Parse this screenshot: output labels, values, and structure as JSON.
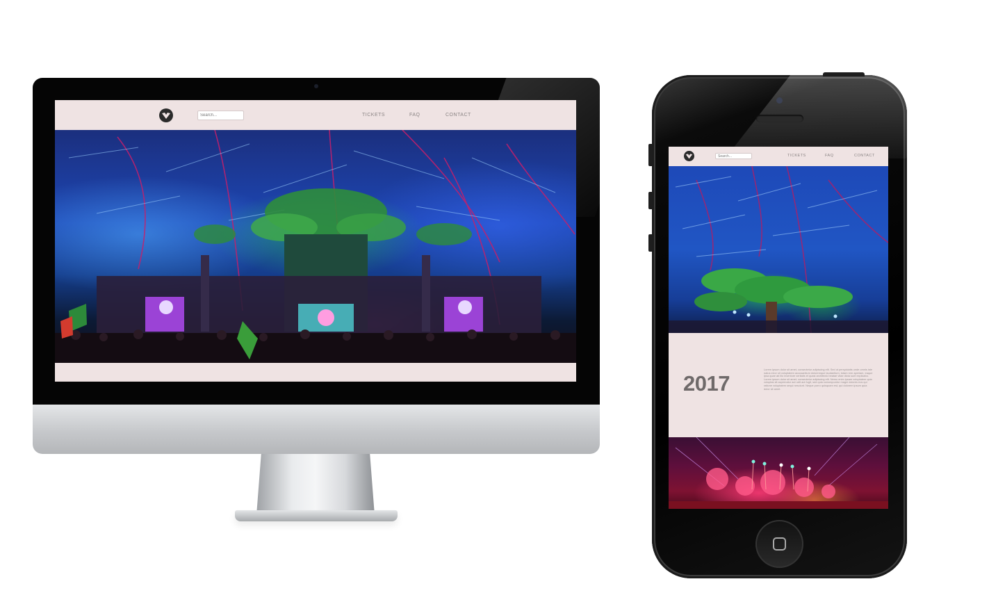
{
  "site": {
    "logo_icon": "tomorrowland-logo-icon",
    "search_placeholder": "Search...",
    "nav": [
      "TICKETS",
      "FAQ",
      "CONTACT"
    ]
  },
  "mobile": {
    "year": "2017",
    "body_text": "Lorem ipsum dolor sit amet, consectetur adipiscing elit. Sed ut perspiciatis unde omnis iste natus error sit voluptatem accusantium doloremque laudantium, totam rem aperiam, eaque ipsa quae ab illo inventore veritatis et quasi architecto beatae vitae dicta sunt explicabo. Lorem ipsum dolor sit amet, consectetur adipiscing elit. Nemo enim ipsam voluptatem quia voluptas sit aspernatur aut odit aut fugit, sed quia consequuntur magni dolores eos qui ratione voluptatem sequi nesciunt. Neque porro quisquam est, qui dolorem ipsum quia dolor sit amet."
  },
  "colors": {
    "header_bg": "#efe3e3",
    "nav_text": "#8a8484",
    "year_text": "#6f6a6a"
  }
}
